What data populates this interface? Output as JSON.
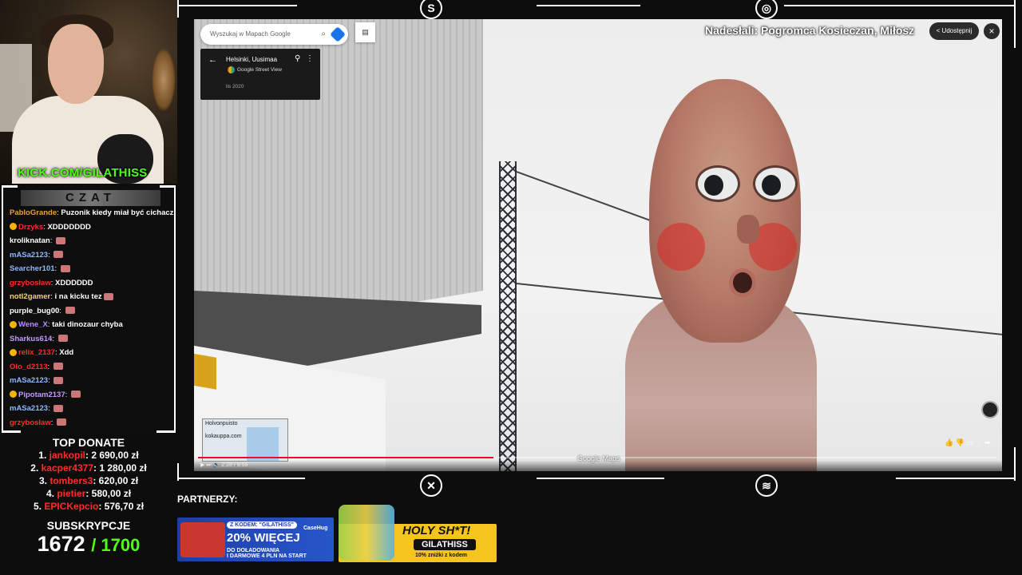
{
  "webcam": {
    "handle_prefix": "KICK.COM/",
    "handle_name": "GILATHISS"
  },
  "chat": {
    "title": "CZAT",
    "messages": [
      {
        "user": "PabloGrande",
        "color": "#e8a13a",
        "text": "Puzonik kiedy miał być cichacz",
        "badge": false,
        "emote": false
      },
      {
        "user": "Drzyks",
        "color": "#ff2c2c",
        "text": "XDDDDDDD",
        "badge": true,
        "emote": false
      },
      {
        "user": "kroliknatan",
        "color": "#ffffff",
        "text": "",
        "badge": false,
        "emote": true
      },
      {
        "user": "mASa2123",
        "color": "#8fb8ff",
        "text": "",
        "badge": false,
        "emote": true
      },
      {
        "user": "Searcher101",
        "color": "#8fb8ff",
        "text": "",
        "badge": false,
        "emote": true
      },
      {
        "user": "grzybosław",
        "color": "#ff2c2c",
        "text": "XDDDDDD",
        "badge": false,
        "emote": false
      },
      {
        "user": "notl2gamer",
        "color": "#f4d27a",
        "text": "i na kicku tez",
        "badge": false,
        "emote": true
      },
      {
        "user": "purple_bug00",
        "color": "#ffffff",
        "text": "",
        "badge": false,
        "emote": true
      },
      {
        "user": "Wene_X",
        "color": "#b68cff",
        "text": "taki dinozaur chyba",
        "badge": true,
        "emote": false
      },
      {
        "user": "Sharkus614",
        "color": "#c39bff",
        "text": "",
        "badge": false,
        "emote": true
      },
      {
        "user": "relix_2137",
        "color": "#ff2c2c",
        "text": "Xdd",
        "badge": true,
        "emote": false
      },
      {
        "user": "Olo_d2113",
        "color": "#ff2c2c",
        "text": "",
        "badge": false,
        "emote": true
      },
      {
        "user": "mASa2123",
        "color": "#8fb8ff",
        "text": "",
        "badge": false,
        "emote": true
      },
      {
        "user": "Pipotam2137",
        "color": "#c39bff",
        "text": "",
        "badge": true,
        "emote": true
      },
      {
        "user": "mASa2123",
        "color": "#8fb8ff",
        "text": "",
        "badge": false,
        "emote": true
      },
      {
        "user": "grzybosław",
        "color": "#ff2c2c",
        "text": "",
        "badge": false,
        "emote": true
      }
    ]
  },
  "top_donate": {
    "title": "TOP DONATE",
    "entries": [
      {
        "rank": "1.",
        "name": "jankopil",
        "amount": ": 2 690,00 zł"
      },
      {
        "rank": "2.",
        "name": "kacper4377",
        "amount": ": 1 280,00 zł"
      },
      {
        "rank": "3.",
        "name": "tombers3",
        "amount": ": 620,00 zł"
      },
      {
        "rank": "4.",
        "name": "pietier",
        "amount": ": 580,00 zł"
      },
      {
        "rank": "5.",
        "name": "EPICKepcio",
        "amount": ": 576,70 zł"
      }
    ]
  },
  "subs": {
    "title": "SUBSKRYPCJE",
    "current": "1672",
    "goal": "/ 1700"
  },
  "viewer": {
    "search_placeholder": "Wyszukaj w Mapach Google",
    "place": "Helsinki, Uusimaa",
    "service": "Google Street View",
    "date": "lis 2020",
    "submitted": "Nadesłali: Pogromca Kosieczan, Miłosz",
    "share_label": "Udostępnij",
    "close_label": "×",
    "minimap_label": "kokauppa.com",
    "minimap_place": "Holvonpuisto",
    "watermark": "Google Maps",
    "time": "2:28 / 9:59",
    "progress": 0.37
  },
  "partners": {
    "title": "PARTNERZY:",
    "banner1": {
      "code": "Z KODEM: \"GILATHISS\"",
      "headline": "20% WIĘCEJ",
      "sub1": "DO DOŁADOWANIA",
      "sub2": "I DARMOWE 4 PLN NA START",
      "brand": "CaseHug"
    },
    "banner2": {
      "headline": "HOLY SH*T!",
      "code": "GILATHISS",
      "sub": "10% zniżki z kodem"
    }
  }
}
